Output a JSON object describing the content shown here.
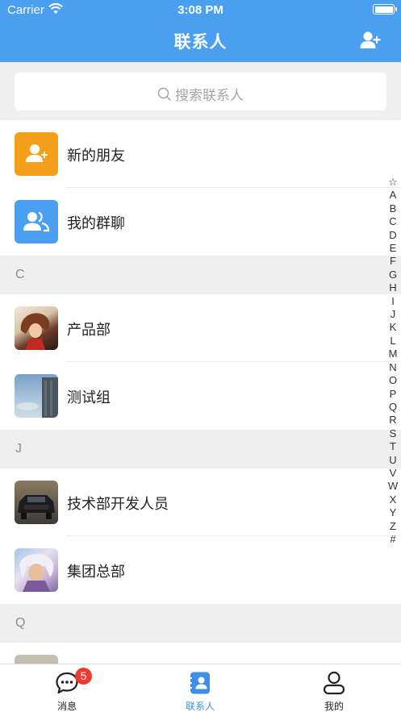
{
  "status_bar": {
    "carrier": "Carrier",
    "time": "3:08 PM"
  },
  "header": {
    "title": "联系人",
    "add_icon": "add-contact-icon"
  },
  "search": {
    "placeholder": "搜索联系人"
  },
  "top_items": [
    {
      "label": "新的朋友",
      "icon": "new-friend-icon",
      "color": "#f5a01a"
    },
    {
      "label": "我的群聊",
      "icon": "group-chat-icon",
      "color": "#4a9ff0"
    }
  ],
  "sections": [
    {
      "letter": "C",
      "items": [
        {
          "label": "产品部"
        },
        {
          "label": "测试组"
        }
      ]
    },
    {
      "letter": "J",
      "items": [
        {
          "label": "技术部开发人员"
        },
        {
          "label": "集团总部"
        }
      ]
    },
    {
      "letter": "Q",
      "items": []
    }
  ],
  "index_letters": [
    "☆",
    "A",
    "B",
    "C",
    "D",
    "E",
    "F",
    "G",
    "H",
    "I",
    "J",
    "K",
    "L",
    "M",
    "N",
    "O",
    "P",
    "Q",
    "R",
    "S",
    "T",
    "U",
    "V",
    "W",
    "X",
    "Y",
    "Z",
    "#"
  ],
  "tabs": [
    {
      "label": "消息",
      "icon": "message-icon",
      "badge": "5"
    },
    {
      "label": "联系人",
      "icon": "contacts-icon",
      "active": true
    },
    {
      "label": "我的",
      "icon": "profile-icon"
    }
  ],
  "colors": {
    "accent": "#4a9ff0",
    "badge": "#ee3b2f",
    "new_friend": "#f5a01a"
  }
}
